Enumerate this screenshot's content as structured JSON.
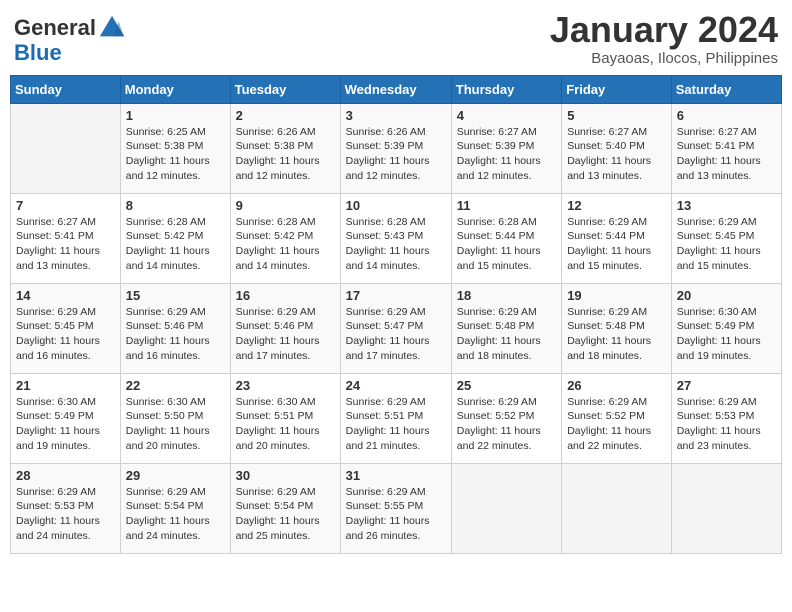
{
  "header": {
    "logo_general": "General",
    "logo_blue": "Blue",
    "title": "January 2024",
    "subtitle": "Bayaoas, Ilocos, Philippines"
  },
  "weekdays": [
    "Sunday",
    "Monday",
    "Tuesday",
    "Wednesday",
    "Thursday",
    "Friday",
    "Saturday"
  ],
  "weeks": [
    [
      {
        "day": "",
        "sunrise": "",
        "sunset": "",
        "daylight": ""
      },
      {
        "day": "1",
        "sunrise": "6:25 AM",
        "sunset": "5:38 PM",
        "daylight": "11 hours and 12 minutes."
      },
      {
        "day": "2",
        "sunrise": "6:26 AM",
        "sunset": "5:38 PM",
        "daylight": "11 hours and 12 minutes."
      },
      {
        "day": "3",
        "sunrise": "6:26 AM",
        "sunset": "5:39 PM",
        "daylight": "11 hours and 12 minutes."
      },
      {
        "day": "4",
        "sunrise": "6:27 AM",
        "sunset": "5:39 PM",
        "daylight": "11 hours and 12 minutes."
      },
      {
        "day": "5",
        "sunrise": "6:27 AM",
        "sunset": "5:40 PM",
        "daylight": "11 hours and 13 minutes."
      },
      {
        "day": "6",
        "sunrise": "6:27 AM",
        "sunset": "5:41 PM",
        "daylight": "11 hours and 13 minutes."
      }
    ],
    [
      {
        "day": "7",
        "sunrise": "6:27 AM",
        "sunset": "5:41 PM",
        "daylight": "11 hours and 13 minutes."
      },
      {
        "day": "8",
        "sunrise": "6:28 AM",
        "sunset": "5:42 PM",
        "daylight": "11 hours and 14 minutes."
      },
      {
        "day": "9",
        "sunrise": "6:28 AM",
        "sunset": "5:42 PM",
        "daylight": "11 hours and 14 minutes."
      },
      {
        "day": "10",
        "sunrise": "6:28 AM",
        "sunset": "5:43 PM",
        "daylight": "11 hours and 14 minutes."
      },
      {
        "day": "11",
        "sunrise": "6:28 AM",
        "sunset": "5:44 PM",
        "daylight": "11 hours and 15 minutes."
      },
      {
        "day": "12",
        "sunrise": "6:29 AM",
        "sunset": "5:44 PM",
        "daylight": "11 hours and 15 minutes."
      },
      {
        "day": "13",
        "sunrise": "6:29 AM",
        "sunset": "5:45 PM",
        "daylight": "11 hours and 15 minutes."
      }
    ],
    [
      {
        "day": "14",
        "sunrise": "6:29 AM",
        "sunset": "5:45 PM",
        "daylight": "11 hours and 16 minutes."
      },
      {
        "day": "15",
        "sunrise": "6:29 AM",
        "sunset": "5:46 PM",
        "daylight": "11 hours and 16 minutes."
      },
      {
        "day": "16",
        "sunrise": "6:29 AM",
        "sunset": "5:46 PM",
        "daylight": "11 hours and 17 minutes."
      },
      {
        "day": "17",
        "sunrise": "6:29 AM",
        "sunset": "5:47 PM",
        "daylight": "11 hours and 17 minutes."
      },
      {
        "day": "18",
        "sunrise": "6:29 AM",
        "sunset": "5:48 PM",
        "daylight": "11 hours and 18 minutes."
      },
      {
        "day": "19",
        "sunrise": "6:29 AM",
        "sunset": "5:48 PM",
        "daylight": "11 hours and 18 minutes."
      },
      {
        "day": "20",
        "sunrise": "6:30 AM",
        "sunset": "5:49 PM",
        "daylight": "11 hours and 19 minutes."
      }
    ],
    [
      {
        "day": "21",
        "sunrise": "6:30 AM",
        "sunset": "5:49 PM",
        "daylight": "11 hours and 19 minutes."
      },
      {
        "day": "22",
        "sunrise": "6:30 AM",
        "sunset": "5:50 PM",
        "daylight": "11 hours and 20 minutes."
      },
      {
        "day": "23",
        "sunrise": "6:30 AM",
        "sunset": "5:51 PM",
        "daylight": "11 hours and 20 minutes."
      },
      {
        "day": "24",
        "sunrise": "6:29 AM",
        "sunset": "5:51 PM",
        "daylight": "11 hours and 21 minutes."
      },
      {
        "day": "25",
        "sunrise": "6:29 AM",
        "sunset": "5:52 PM",
        "daylight": "11 hours and 22 minutes."
      },
      {
        "day": "26",
        "sunrise": "6:29 AM",
        "sunset": "5:52 PM",
        "daylight": "11 hours and 22 minutes."
      },
      {
        "day": "27",
        "sunrise": "6:29 AM",
        "sunset": "5:53 PM",
        "daylight": "11 hours and 23 minutes."
      }
    ],
    [
      {
        "day": "28",
        "sunrise": "6:29 AM",
        "sunset": "5:53 PM",
        "daylight": "11 hours and 24 minutes."
      },
      {
        "day": "29",
        "sunrise": "6:29 AM",
        "sunset": "5:54 PM",
        "daylight": "11 hours and 24 minutes."
      },
      {
        "day": "30",
        "sunrise": "6:29 AM",
        "sunset": "5:54 PM",
        "daylight": "11 hours and 25 minutes."
      },
      {
        "day": "31",
        "sunrise": "6:29 AM",
        "sunset": "5:55 PM",
        "daylight": "11 hours and 26 minutes."
      },
      {
        "day": "",
        "sunrise": "",
        "sunset": "",
        "daylight": ""
      },
      {
        "day": "",
        "sunrise": "",
        "sunset": "",
        "daylight": ""
      },
      {
        "day": "",
        "sunrise": "",
        "sunset": "",
        "daylight": ""
      }
    ]
  ]
}
